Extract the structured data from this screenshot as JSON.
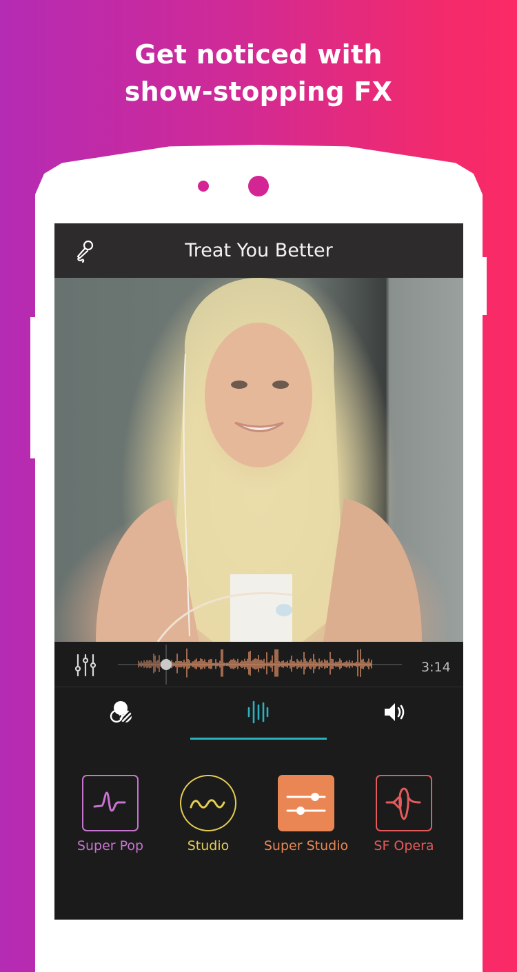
{
  "promo": {
    "headline_line1": "Get noticed with",
    "headline_line2": "show-stopping FX"
  },
  "colors": {
    "background_gradient_start": "#b42bb4",
    "background_gradient_end": "#fb2a66",
    "phone_dot": "#d42594",
    "topbar_bg": "#2d2b2c",
    "panel_bg": "#1b1b1b",
    "waveform": "#e8956a",
    "active_tab": "#2bb2bd"
  },
  "app": {
    "header": {
      "icon": "microphone-icon",
      "song_title": "Treat You Better"
    },
    "video": {
      "description": "singer video frame"
    },
    "player": {
      "mixer_icon": "mixer-sliders-icon",
      "duration": "3:14",
      "playhead_position": 0.17
    },
    "tabs": [
      {
        "name": "vocal-blend",
        "icon": "vocal-blend-icon",
        "active": false
      },
      {
        "name": "effects",
        "icon": "waveform-bars-icon",
        "active": true
      },
      {
        "name": "volume",
        "icon": "speaker-icon",
        "active": false
      }
    ],
    "effects": [
      {
        "label": "Super Pop",
        "icon": "super-pop-icon",
        "color": "#c774cf",
        "selected": false
      },
      {
        "label": "Studio",
        "icon": "studio-wave-icon",
        "color": "#e4cd55",
        "selected": false
      },
      {
        "label": "Super Studio",
        "icon": "sliders-icon",
        "color": "#e98654",
        "selected": true
      },
      {
        "label": "SF Opera",
        "icon": "sf-opera-icon",
        "color": "#e45b5b",
        "selected": false
      }
    ]
  }
}
